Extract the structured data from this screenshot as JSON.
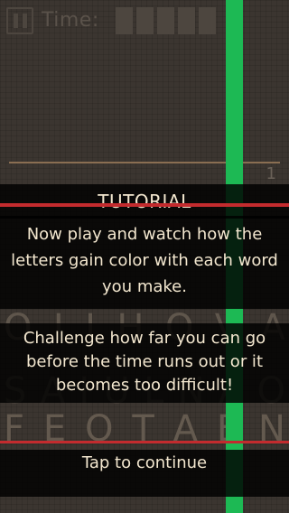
{
  "header": {
    "time_label": "Time:"
  },
  "board": {
    "count": "1",
    "row_a": [
      "O",
      "I",
      "I",
      "H",
      "O",
      "V",
      "A"
    ],
    "row_b": [
      "S",
      "A",
      "I",
      "U",
      "L",
      "N",
      "A",
      "O"
    ],
    "row_c": [
      "F",
      "E",
      "O",
      "T",
      "A",
      "E",
      "N"
    ]
  },
  "tutorial": {
    "title": "TUTORIAL",
    "message_1": "Now play and watch how the letters gain color with each word you make.",
    "message_2": "Challenge how far you can go before the time runs out or it becomes too difficult!",
    "tap_hint": "Tap to continue"
  },
  "colors": {
    "accent_green": "#1db954",
    "accent_red": "#c32b2e",
    "text_cream": "#f3e7cf"
  }
}
